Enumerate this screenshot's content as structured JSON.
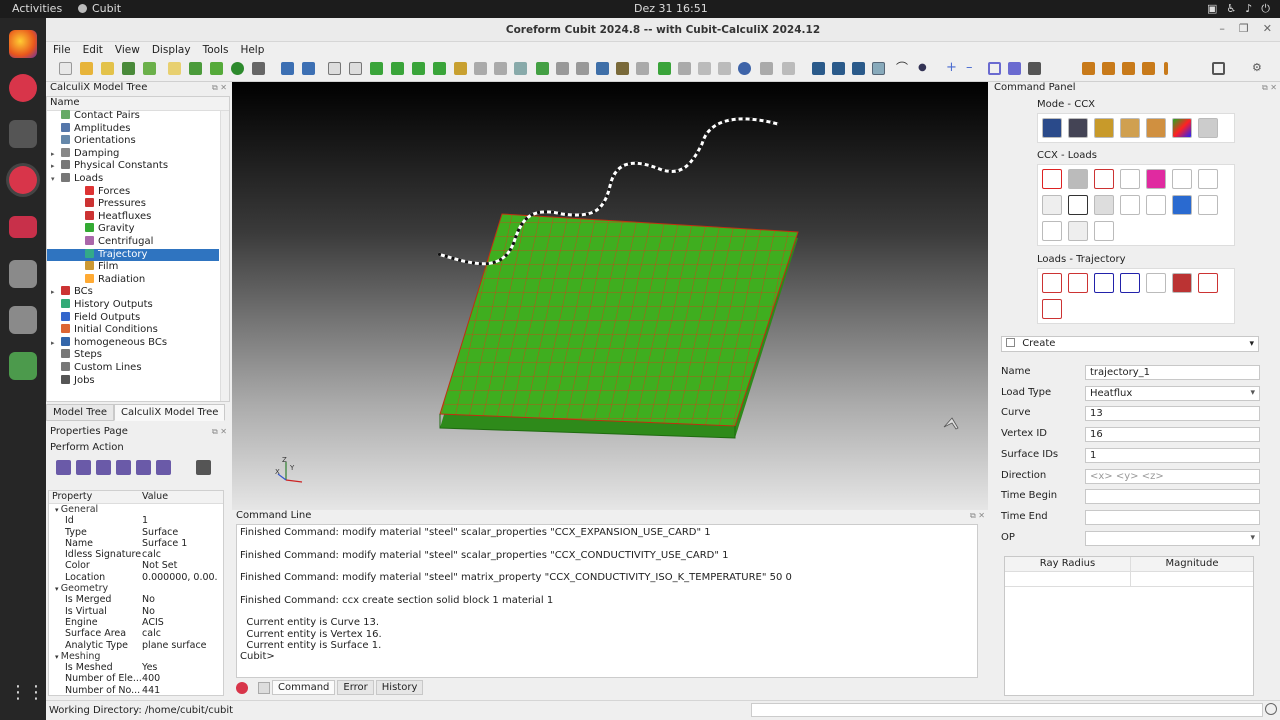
{
  "system": {
    "activities": "Activities",
    "app": "Cubit",
    "clock": "Dez 31  16:51"
  },
  "window": {
    "title": "Coreform Cubit 2024.8 -- with Cubit-CalculiX 2024.12"
  },
  "menu": [
    "File",
    "Edit",
    "View",
    "Display",
    "Tools",
    "Help"
  ],
  "tree": {
    "title": "CalculiX Model Tree",
    "column": "Name",
    "items": [
      "Contact Pairs",
      "Amplitudes",
      "Orientations",
      "Damping",
      "Physical Constants",
      "Loads",
      "Forces",
      "Pressures",
      "Heatfluxes",
      "Gravity",
      "Centrifugal",
      "Trajectory",
      "Film",
      "Radiation",
      "BCs",
      "History Outputs",
      "Field Outputs",
      "Initial Conditions",
      "homogeneous BCs",
      "Steps",
      "Custom Lines",
      "Jobs"
    ],
    "tabs": [
      "Model Tree",
      "CalculiX Model Tree"
    ]
  },
  "props": {
    "title": "Properties Page",
    "action": "Perform Action",
    "col_property": "Property",
    "col_value": "Value",
    "rows": [
      [
        "General",
        ""
      ],
      [
        "Id",
        "1"
      ],
      [
        "Type",
        "Surface"
      ],
      [
        "Name",
        "Surface 1"
      ],
      [
        "Idless Signature",
        "calc"
      ],
      [
        "Color",
        "Not Set"
      ],
      [
        "Location",
        "0.000000, 0.00."
      ],
      [
        "Geometry",
        ""
      ],
      [
        "Is Merged",
        "No"
      ],
      [
        "Is Virtual",
        "No"
      ],
      [
        "Engine",
        "ACIS"
      ],
      [
        "Surface Area",
        "calc"
      ],
      [
        "Analytic Type",
        "plane surface"
      ],
      [
        "Meshing",
        ""
      ],
      [
        "Is Meshed",
        "Yes"
      ],
      [
        "Number of Ele...",
        "400"
      ],
      [
        "Number of No...",
        "441"
      ]
    ]
  },
  "command": {
    "title": "Command Line",
    "lines": [
      "Finished Command: modify material \"steel\" scalar_properties \"CCX_EXPANSION_USE_CARD\" 1",
      "",
      "Finished Command: modify material \"steel\" scalar_properties \"CCX_CONDUCTIVITY_USE_CARD\" 1",
      "",
      "Finished Command: modify material \"steel\" matrix_property \"CCX_CONDUCTIVITY_ISO_K_TEMPERATURE\" 50 0",
      "",
      "Finished Command: ccx create section solid block 1 material 1",
      "",
      "  Current entity is Curve 13.",
      "  Current entity is Vertex 16.",
      "  Current entity is Surface 1.",
      "Cubit>"
    ],
    "tabs": [
      "Command",
      "Error",
      "History"
    ]
  },
  "panel": {
    "title": "Command Panel",
    "mode": "Mode - CCX",
    "loads": "CCX - Loads",
    "traj": "Loads - Trajectory",
    "create": "Create",
    "fields": [
      {
        "label": "Name",
        "value": "trajectory_1",
        "dropdown": false
      },
      {
        "label": "Load Type",
        "value": "Heatflux",
        "dropdown": true
      },
      {
        "label": "Curve",
        "value": "13",
        "dropdown": false
      },
      {
        "label": "Vertex ID",
        "value": "16",
        "dropdown": false
      },
      {
        "label": "Surface IDs",
        "value": "1",
        "dropdown": false
      },
      {
        "label": "Direction",
        "value": "",
        "placeholder": "<x> <y> <z>",
        "dropdown": false
      },
      {
        "label": "Time Begin",
        "value": "",
        "dropdown": false
      },
      {
        "label": "Time End",
        "value": "",
        "dropdown": false
      },
      {
        "label": "OP",
        "value": "",
        "dropdown": true
      }
    ],
    "table_cols": [
      "Ray Radius",
      "Magnitude"
    ]
  },
  "status": {
    "workdir": "Working Directory: /home/cubit/cubit"
  },
  "colors": {
    "mesh_green": "#3fae1f",
    "mesh_edge": "#d63a1a",
    "selection": "#2f74c0"
  }
}
